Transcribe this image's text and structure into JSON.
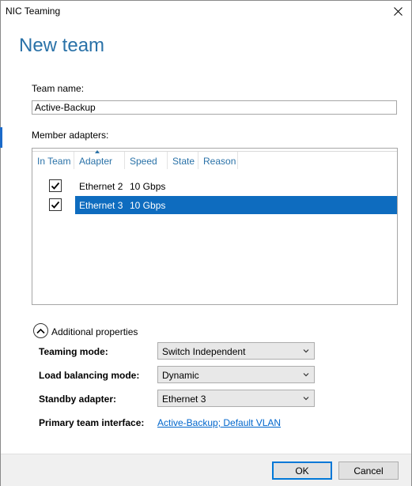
{
  "window": {
    "title": "NIC Teaming",
    "heading": "New team"
  },
  "team_name": {
    "label": "Team name:",
    "value": "Active-Backup"
  },
  "member_adapters": {
    "label": "Member adapters:",
    "columns": [
      "In Team",
      "Adapter",
      "Speed",
      "State",
      "Reason"
    ],
    "sorted_column": "Adapter",
    "rows": [
      {
        "in_team": true,
        "adapter": "Ethernet 2",
        "speed": "10 Gbps",
        "state": "",
        "reason": "",
        "selected": false
      },
      {
        "in_team": true,
        "adapter": "Ethernet 3",
        "speed": "10 Gbps",
        "state": "",
        "reason": "",
        "selected": true
      }
    ]
  },
  "additional_properties": {
    "toggle_label": "Additional properties",
    "expanded": true,
    "teaming_mode": {
      "label": "Teaming mode:",
      "value": "Switch Independent"
    },
    "load_balancing_mode": {
      "label": "Load balancing mode:",
      "value": "Dynamic"
    },
    "standby_adapter": {
      "label": "Standby adapter:",
      "value": "Ethernet 3"
    },
    "primary_team_interface": {
      "label": "Primary team interface:",
      "link_text": "Active-Backup; Default VLAN"
    }
  },
  "buttons": {
    "ok": "OK",
    "cancel": "Cancel"
  },
  "colors": {
    "heading": "#2a72a8",
    "selection": "#0e6cbf",
    "link": "#0066cc",
    "column_header": "#2a72a8"
  }
}
